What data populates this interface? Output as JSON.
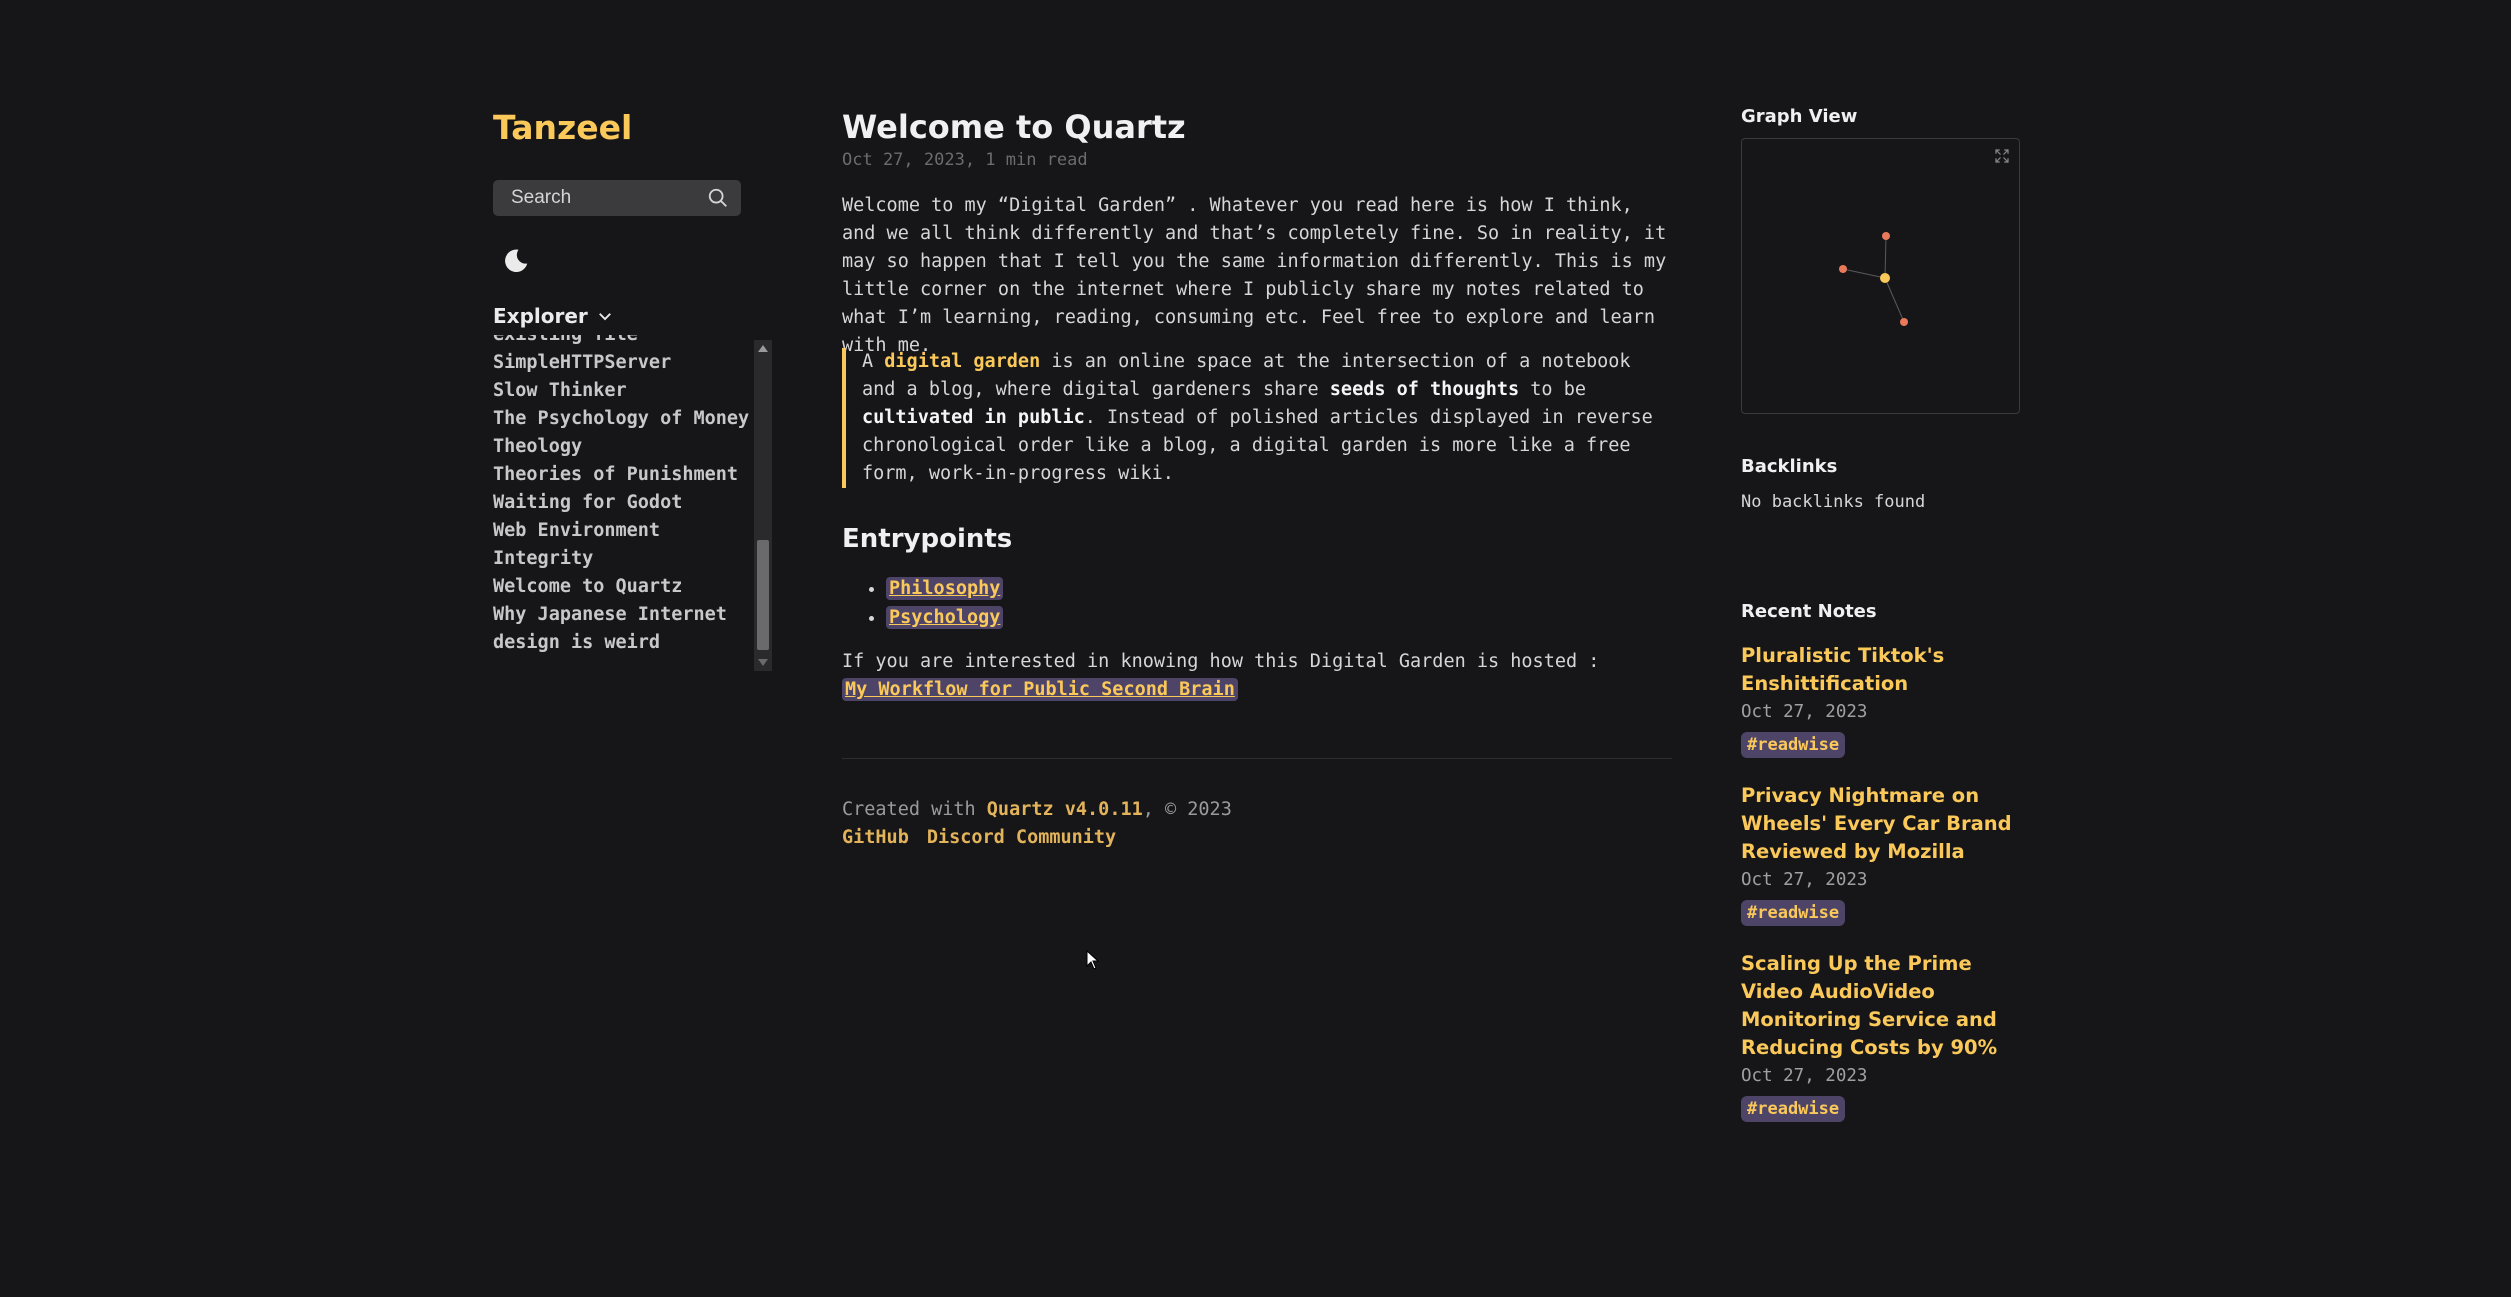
{
  "site": {
    "title": "Tanzeel"
  },
  "search": {
    "placeholder": "Search"
  },
  "explorer": {
    "title": "Explorer",
    "items": [
      "existing file",
      "SimpleHTTPServer",
      "Slow Thinker",
      "The Psychology of Money",
      "Theology",
      "Theories of Punishment",
      "Waiting for Godot",
      "Web Environment",
      "Integrity",
      "Welcome to Quartz",
      "Why Japanese Internet",
      "design is weird"
    ]
  },
  "article": {
    "title": "Welcome to Quartz",
    "meta": "Oct 27, 2023, 1 min read",
    "intro": "Welcome to my “Digital Garden” . Whatever you read here is how I think, and we all think differently and that’s completely fine. So in reality, it may so happen that I tell you the same information differently. This is my little corner on the internet where I publicly share my notes related to what I’m learning, reading, consuming etc. Feel free to explore and learn with me.",
    "quote": {
      "a": "A ",
      "digital_garden": "digital garden",
      "b": " is an online space at the intersection of a notebook and a blog, where digital gardeners share ",
      "seeds": "seeds of thoughts",
      "c": " to be ",
      "cultivated": "cultivated in public",
      "d": ". Instead of polished articles displayed in reverse chronological order like a blog, a digital garden is more like a free form, work-in-progress wiki."
    },
    "entrypoints_title": "Entrypoints",
    "entrypoints": [
      "Philosophy",
      "Psychology"
    ],
    "hosted_text": "If you are interested in knowing how this Digital Garden is hosted :",
    "hosted_link": "My Workflow for Public Second Brain"
  },
  "footer": {
    "created_prefix": "Created with ",
    "quartz_link": "Quartz v4.0.11",
    "created_suffix": ", © 2023",
    "github": "GitHub",
    "discord": "Discord Community"
  },
  "graph": {
    "title": "Graph View"
  },
  "backlinks": {
    "title": "Backlinks",
    "empty": "No backlinks found"
  },
  "recent": {
    "title": "Recent Notes",
    "notes": [
      {
        "title": "Pluralistic Tiktok's Enshittification",
        "date": "Oct 27, 2023",
        "tag": "#readwise"
      },
      {
        "title": "Privacy Nightmare on Wheels' Every Car Brand Reviewed by Mozilla",
        "date": "Oct 27, 2023",
        "tag": "#readwise"
      },
      {
        "title": "Scaling Up the Prime Video AudioVideo Monitoring Service and Reducing Costs by 90%",
        "date": "Oct 27, 2023",
        "tag": "#readwise"
      }
    ]
  },
  "colors": {
    "accent": "#fbc95a",
    "background": "#161618",
    "tag_bg": "#4d4468",
    "graph_node": "#e8795a"
  }
}
